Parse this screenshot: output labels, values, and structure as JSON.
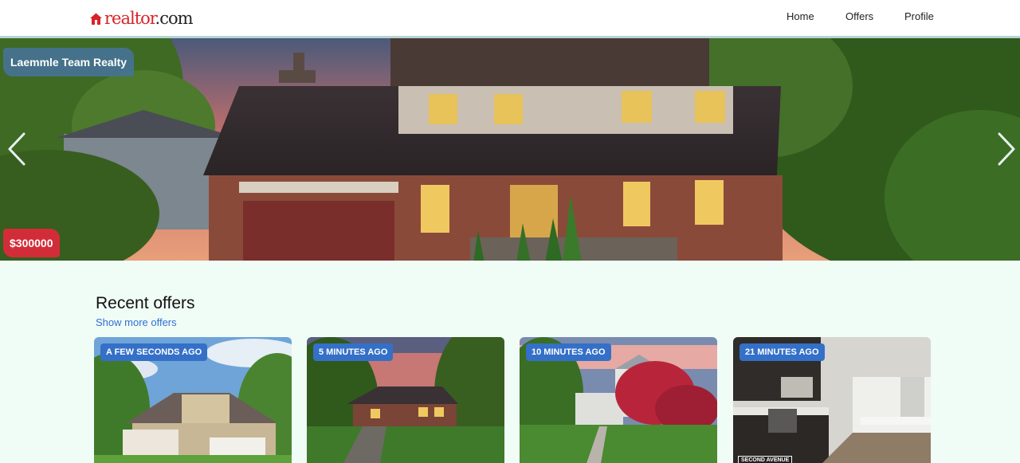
{
  "header": {
    "logo_text": "realtor",
    "logo_suffix": ".com",
    "nav": [
      {
        "label": "Home"
      },
      {
        "label": "Offers"
      },
      {
        "label": "Profile"
      }
    ]
  },
  "hero": {
    "agency": "Laemmle Team Realty",
    "price": "$300000"
  },
  "recent": {
    "title": "Recent offers",
    "show_more": "Show more offers",
    "offers": [
      {
        "time": "A FEW SECONDS AGO"
      },
      {
        "time": "5 MINUTES AGO"
      },
      {
        "time": "10 MINUTES AGO"
      },
      {
        "time": "21 MINUTES AGO",
        "watermark": "SECOND AVENUE"
      }
    ]
  },
  "colors": {
    "brand": "#d92228",
    "accent": "#3470c8",
    "background": "#f0fcf6"
  }
}
